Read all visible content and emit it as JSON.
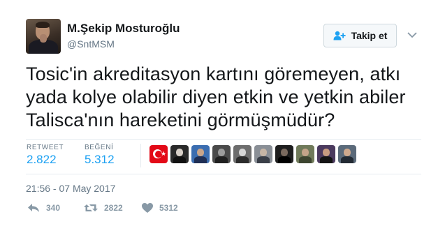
{
  "user": {
    "name": "M.Şekip Mosturoğlu",
    "handle": "@SntMSM"
  },
  "follow_button": {
    "label": "Takip et",
    "icon": "add-user-icon"
  },
  "tweet": {
    "text_lines": [
      "Tosic'in akreditasyon kartını göremeyen, atkı",
      "yada kolye olabilir diyen etkin ve yetkin abiler",
      "Talisca'nın hareketini görmüşmüdür?"
    ],
    "timestamp": "21:56 - 07 May 2017"
  },
  "stats": {
    "retweet_label": "RETWEET",
    "retweet_value": "2.822",
    "like_label": "BEĞENİ",
    "like_value": "5.312"
  },
  "likers": [
    {
      "icon": "turkish-flag-avatar",
      "bg": "#e30a17"
    },
    {
      "icon": "liker-avatar",
      "bg": "#2a2a2a",
      "face": "#d8d0c8",
      "body": "#111111"
    },
    {
      "icon": "liker-avatar",
      "bg": "#3b6db0",
      "face": "#c9a58a",
      "body": "#1f2f55"
    },
    {
      "icon": "liker-avatar",
      "bg": "#4a4a4a",
      "face": "#9c9c9c",
      "body": "#202020"
    },
    {
      "icon": "liker-avatar",
      "bg": "#6d6d6d",
      "face": "#d6d6d6",
      "body": "#2c2c2c"
    },
    {
      "icon": "liker-avatar",
      "bg": "#8a8f96",
      "face": "#c7b6a6",
      "body": "#3a3f48"
    },
    {
      "icon": "liker-avatar",
      "bg": "#1e1e1e",
      "face": "#7a6a5e",
      "body": "#000000"
    },
    {
      "icon": "liker-avatar",
      "bg": "#707a5a",
      "face": "#c4a489",
      "body": "#3d4530"
    },
    {
      "icon": "liker-avatar",
      "bg": "#4b3a5e",
      "face": "#c89c80",
      "body": "#141414"
    },
    {
      "icon": "liker-avatar",
      "bg": "#5b6a7a",
      "face": "#cfa98d",
      "body": "#222a33"
    }
  ],
  "actions": {
    "reply_count": "340",
    "retweet_count": "2822",
    "like_count": "5312"
  },
  "colors": {
    "accent": "#1da1f2",
    "muted": "#657786",
    "action": "#8899a6",
    "border": "#e6ecf0"
  }
}
